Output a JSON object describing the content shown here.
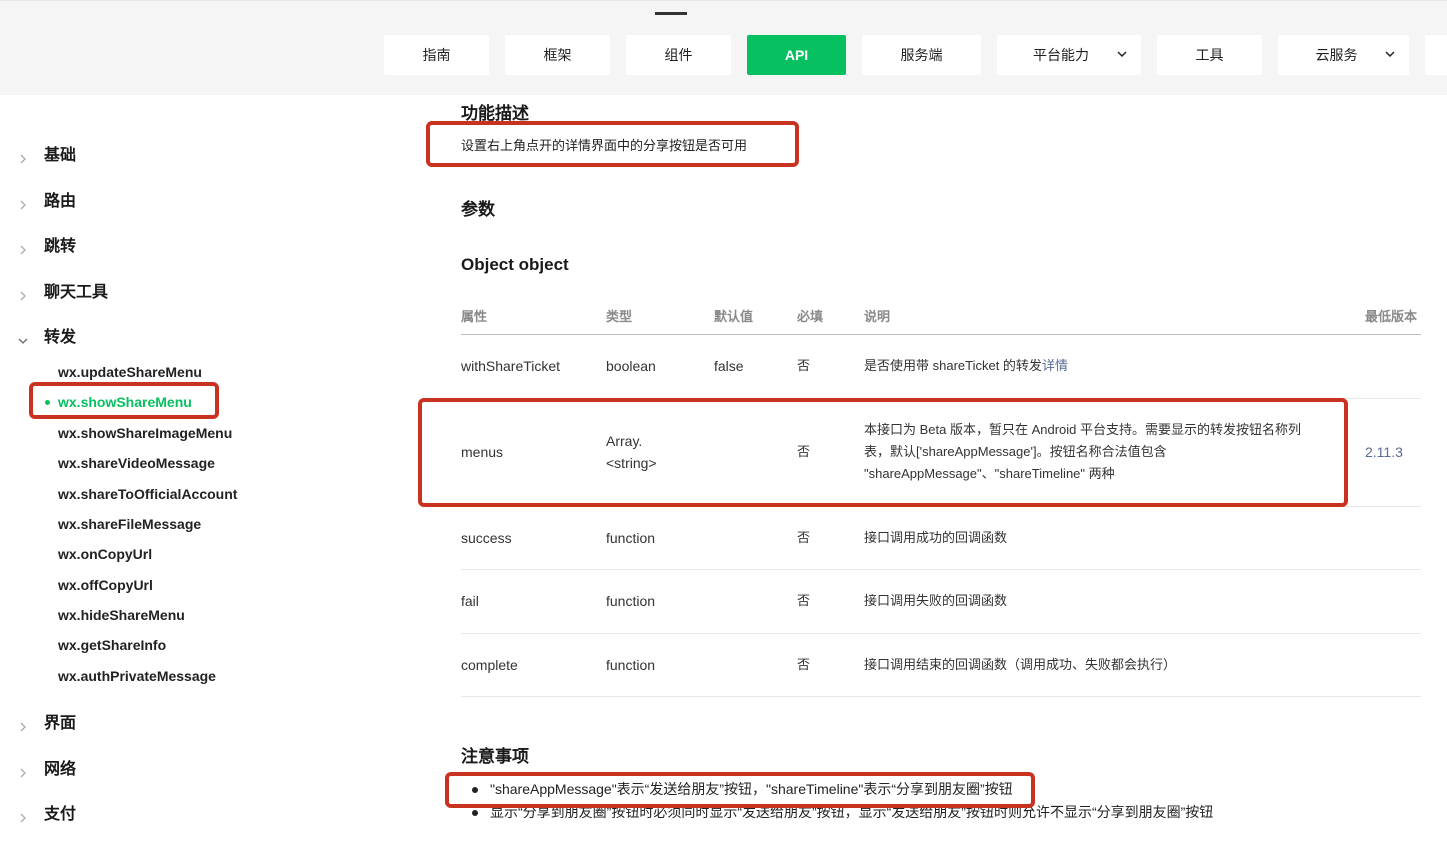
{
  "nav": {
    "tabs": [
      {
        "label": "指南",
        "active": false,
        "dropdown": false
      },
      {
        "label": "框架",
        "active": false,
        "dropdown": false
      },
      {
        "label": "组件",
        "active": false,
        "dropdown": false
      },
      {
        "label": "API",
        "active": true,
        "dropdown": false
      },
      {
        "label": "服务端",
        "active": false,
        "dropdown": false
      },
      {
        "label": "平台能力",
        "active": false,
        "dropdown": true
      },
      {
        "label": "工具",
        "active": false,
        "dropdown": false
      },
      {
        "label": "云服务",
        "active": false,
        "dropdown": true
      }
    ]
  },
  "sidebar": {
    "categories": {
      "basic": "基础",
      "route": "路由",
      "navigate": "跳转",
      "chat_tools": "聊天工具",
      "share": "转发",
      "ui": "界面",
      "network": "网络",
      "payment": "支付"
    },
    "share_items": [
      "wx.updateShareMenu",
      "wx.showShareMenu",
      "wx.showShareImageMenu",
      "wx.shareVideoMessage",
      "wx.shareToOfficialAccount",
      "wx.shareFileMessage",
      "wx.onCopyUrl",
      "wx.offCopyUrl",
      "wx.hideShareMenu",
      "wx.getShareInfo",
      "wx.authPrivateMessage"
    ],
    "active_item": "wx.showShareMenu"
  },
  "content": {
    "func_title": "功能描述",
    "func_desc": "设置右上角点开的详情界面中的分享按钮是否可用",
    "params_title": "参数",
    "object_title": "Object object",
    "table": {
      "headers": [
        "属性",
        "类型",
        "默认值",
        "必填",
        "说明",
        "最低版本"
      ],
      "rows": [
        {
          "attr": "withShareTicket",
          "type": "boolean",
          "default": "false",
          "required": "否",
          "desc": "是否使用带 shareTicket 的转发",
          "desc_link": "详情",
          "version": ""
        },
        {
          "attr": "menus",
          "type_line1": "Array.",
          "type_line2": "<string>",
          "default": "",
          "required": "否",
          "desc": "本接口为 Beta 版本，暂只在 Android 平台支持。需要显示的转发按钮名称列表，默认['shareAppMessage']。按钮名称合法值包含 \"shareAppMessage\"、\"shareTimeline\" 两种",
          "version": "2.11.3"
        },
        {
          "attr": "success",
          "type": "function",
          "default": "",
          "required": "否",
          "desc": "接口调用成功的回调函数",
          "version": ""
        },
        {
          "attr": "fail",
          "type": "function",
          "default": "",
          "required": "否",
          "desc": "接口调用失败的回调函数",
          "version": ""
        },
        {
          "attr": "complete",
          "type": "function",
          "default": "",
          "required": "否",
          "desc": "接口调用结束的回调函数（调用成功、失败都会执行）",
          "version": ""
        }
      ]
    },
    "notes_title": "注意事项",
    "notes": [
      "\"shareAppMessage\"表示“发送给朋友”按钮，\"shareTimeline\"表示“分享到朋友圈”按钮",
      "显示“分享到朋友圈”按钮时必须同时显示“发送给朋友”按钮，显示“发送给朋友”按钮时则允许不显示“分享到朋友圈”按钮"
    ]
  },
  "colors": {
    "accent": "#07c160",
    "highlight_box": "#c8321e",
    "link": "#576b95"
  }
}
